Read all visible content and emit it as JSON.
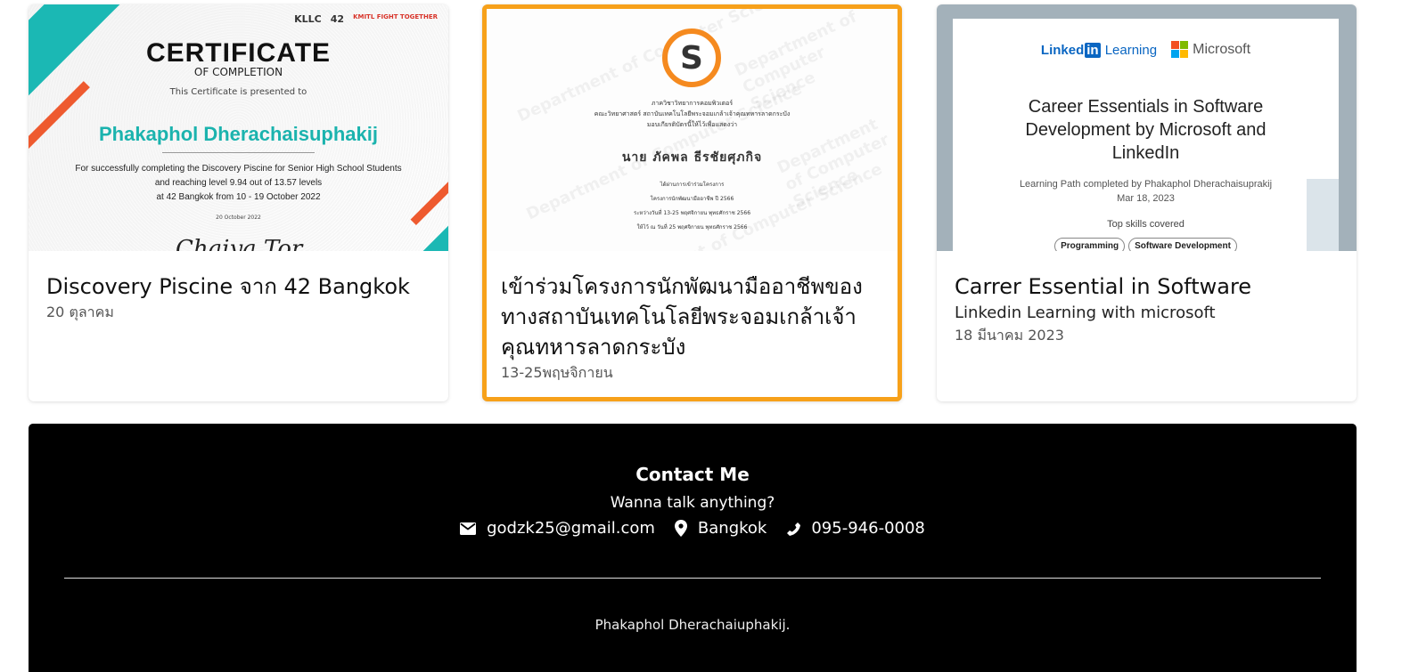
{
  "cards": [
    {
      "title": "Discovery Piscine จาก 42 Bangkok",
      "subtitle": "",
      "date": "20 ตุลาคม",
      "certificate": {
        "brand_left": "KLLC",
        "brand_mid": "42",
        "brand_right": "KMITL FIGHT TOGETHER",
        "heading": "CERTIFICATE",
        "subheading": "OF COMPLETION",
        "presented": "This Certificate is presented to",
        "name": "Phakaphol Dherachaisuphakij",
        "description": "For successfully completing the Discovery Piscine for Senior High School Students\nand reaching level 9.94 out of 13.57 levels\nat 42 Bangkok from 10 - 19 October 2022",
        "issue_date": "20 October 2022"
      }
    },
    {
      "title": "เข้าร่วมโครงการนักพัฒนามืออาชีพของทางสถาบันเทคโนโลยีพระจอมเกล้าเจ้าคุณทหารลาดกระบัง",
      "subtitle": "",
      "date": "13-25พฤษจิกายน",
      "certificate": {
        "watermark": "Department of Computer Science",
        "org_lines": "ภาควิชาวิทยาการคอมพิวเตอร์\nคณะวิทยาศาสตร์ สถาบันเทคโนโลยีพระจอมเกล้าเจ้าคุณทหารลาดกระบัง\nมอบเกียรติบัตรนี้ให้ไว้เพื่อแสดงว่า",
        "name": "นาย ภัคพล ธีรชัยศุภกิจ",
        "detail_lines": "ได้ผ่านการเข้าร่วมโครงการ\nโครงการนักพัฒนามืออาชีพ ปี 2566\nระหว่างวันที่ 13-25 พฤศจิกายน พุทธศักราช 2566\nให้ไว้ ณ วันที่ 25 พฤศจิกายน พุทธศักราช 2566"
      }
    },
    {
      "title": "Carrer Essential in Software",
      "subtitle": "Linkedin Learning with microsoft",
      "date": "18 มีนาคม 2023",
      "certificate": {
        "linkedin": "Linked",
        "linkedin_in": "in",
        "learning": "Learning",
        "microsoft": "Microsoft",
        "title": "Career Essentials in Software Development by Microsoft and LinkedIn",
        "path": "Learning Path completed by Phakaphol Dherachaisuprakij\nMar 18, 2023",
        "skills_label": "Top skills covered",
        "skills": [
          "Programming",
          "Software Development"
        ]
      }
    }
  ],
  "footer": {
    "heading": "Contact Me",
    "tagline": "Wanna talk anything?",
    "email": "godzk25@gmail.com",
    "location": "Bangkok",
    "phone": "095-946-0008",
    "copyright": "Phakaphol Dherachaiuphakij."
  },
  "colors": {
    "teal": "#1bb8b4",
    "orange_border": "#f7a11a",
    "linkedin_blue": "#0a66c2",
    "footer_bg": "#000000"
  }
}
